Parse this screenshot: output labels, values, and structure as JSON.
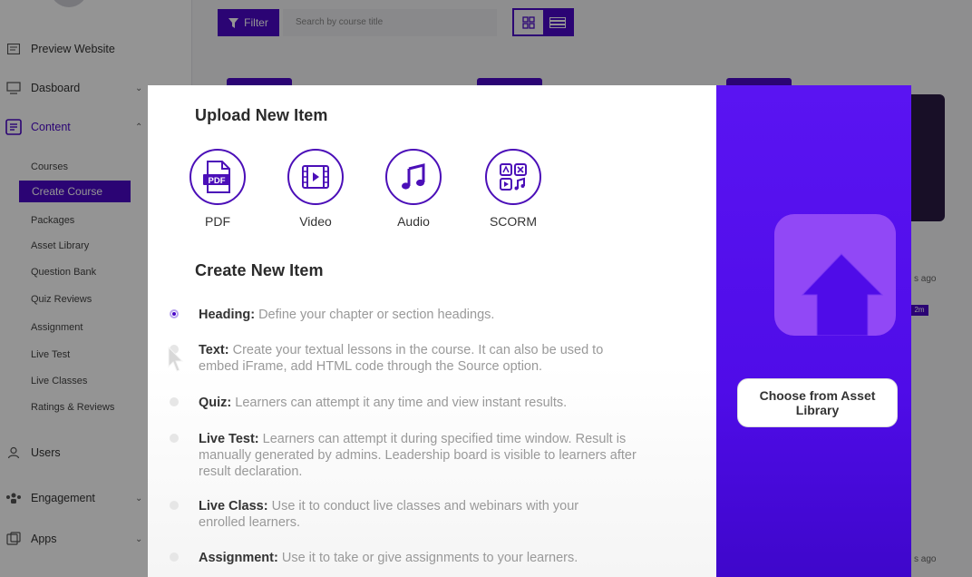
{
  "sidebar": {
    "items": [
      {
        "label": "Preview Website",
        "icon": "preview-icon"
      },
      {
        "label": "Dasboard",
        "icon": "dashboard-icon"
      },
      {
        "label": "Content",
        "icon": "content-icon"
      },
      {
        "label": "Users",
        "icon": "users-icon"
      },
      {
        "label": "Engagement",
        "icon": "engagement-icon"
      },
      {
        "label": "Apps",
        "icon": "apps-icon"
      }
    ],
    "content_subitems": [
      "Courses",
      "Create Course",
      "Packages",
      "Asset Library",
      "Question Bank",
      "Quiz Reviews",
      "Assignment",
      "Live Test",
      "Live Classes",
      "Ratings & Reviews"
    ]
  },
  "toolbar": {
    "filter_label": "Filter",
    "search_placeholder": "Search by course title"
  },
  "background": {
    "ago_text": "s ago",
    "badge_text": "2m"
  },
  "modal": {
    "upload_title": "Upload New Item",
    "upload_types": [
      {
        "label": "PDF",
        "icon": "pdf-icon"
      },
      {
        "label": "Video",
        "icon": "video-icon"
      },
      {
        "label": "Audio",
        "icon": "audio-icon"
      },
      {
        "label": "SCORM",
        "icon": "scorm-icon"
      }
    ],
    "create_title": "Create New Item",
    "create_items": [
      {
        "name": "Heading:",
        "desc": "Define your chapter or section headings."
      },
      {
        "name": "Text:",
        "desc": "Create your textual lessons in the course. It can also be used to embed iFrame, add HTML code through the Source option."
      },
      {
        "name": "Quiz:",
        "desc": "Learners can attempt it any time and view instant results."
      },
      {
        "name": "Live Test:",
        "desc": "Learners can attempt it during specified time window. Result is manually generated by admins. Leadership board is visible to learners after result declaration."
      },
      {
        "name": "Live Class:",
        "desc": "Use it to conduct live classes and webinars with your enrolled learners."
      },
      {
        "name": "Assignment:",
        "desc": "Use it to take or give assignments to your learners."
      }
    ],
    "asset_button_label": "Choose from Asset Library"
  },
  "colors": {
    "accent": "#4a08c8",
    "panel": "#5a14f2",
    "upload_tile": "#9148f6"
  }
}
